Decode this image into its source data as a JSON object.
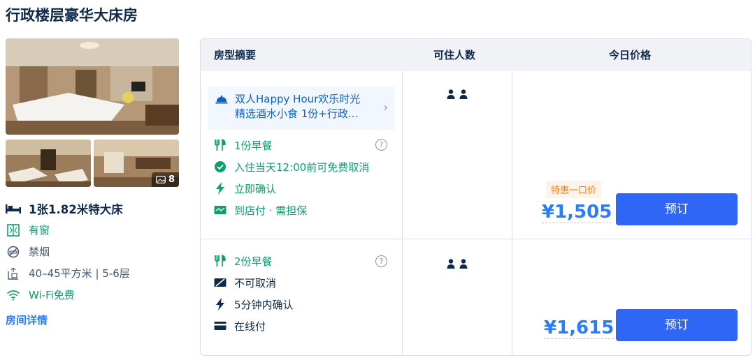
{
  "room": {
    "title": "行政楼层豪华大床房",
    "photo_count": "8",
    "bed": "1张1.82米特大床",
    "window": "有窗",
    "smoking": "禁烟",
    "area_floor": "40–45平方米 | 5-6层",
    "wifi": "Wi-Fi免费",
    "details_link": "房间详情"
  },
  "table": {
    "headers": [
      "房型摘要",
      "可住人数",
      "今日价格"
    ],
    "rows": [
      {
        "promo_line1": "双人Happy Hour欢乐时光",
        "promo_line2": "精选酒水小食 1份+行政...",
        "breakfast": "1份早餐",
        "cancel": "入住当天12:00前可免费取消",
        "confirm": "立即确认",
        "payment": "到店付 · 需担保",
        "tag": "特惠一口价",
        "price": "¥1,505",
        "book": "预订"
      },
      {
        "breakfast": "2份早餐",
        "cancel": "不可取消",
        "confirm": "5分钟内确认",
        "payment": "在线付",
        "price": "¥1,615",
        "book": "预订"
      }
    ]
  },
  "colors": {
    "accent_blue": "#287dfa",
    "button_blue": "#2f66f6",
    "green": "#0d9f6e",
    "orange": "#ff7d13"
  }
}
